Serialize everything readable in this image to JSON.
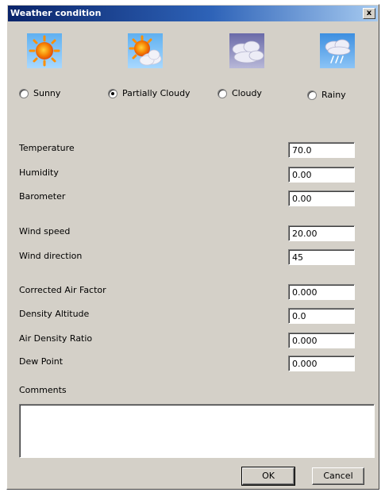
{
  "window": {
    "title": "Weather condition",
    "close_label": "x"
  },
  "conditions": [
    {
      "label": "Sunny",
      "icon": "sun-icon",
      "checked": false
    },
    {
      "label": "Partially Cloudy",
      "icon": "partly-cloudy-icon",
      "checked": true
    },
    {
      "label": "Cloudy",
      "icon": "cloud-icon",
      "checked": false
    },
    {
      "label": "Rainy",
      "icon": "rain-icon",
      "checked": false
    }
  ],
  "fields": {
    "temperature": {
      "label": "Temperature",
      "value": "70.0"
    },
    "humidity": {
      "label": "Humidity",
      "value": "0.00"
    },
    "barometer": {
      "label": "Barometer",
      "value": "0.00"
    },
    "wind_speed": {
      "label": "Wind speed",
      "value": "20.00"
    },
    "wind_direction": {
      "label": "Wind direction",
      "value": "45"
    },
    "corrected_air_factor": {
      "label": "Corrected Air Factor",
      "value": "0.000"
    },
    "density_altitude": {
      "label": "Density Altitude",
      "value": "0.0"
    },
    "air_density_ratio": {
      "label": "Air Density Ratio",
      "value": "0.000"
    },
    "dew_point": {
      "label": "Dew Point",
      "value": "0.000"
    }
  },
  "comments": {
    "label": "Comments",
    "value": ""
  },
  "buttons": {
    "ok": "OK",
    "cancel": "Cancel"
  }
}
